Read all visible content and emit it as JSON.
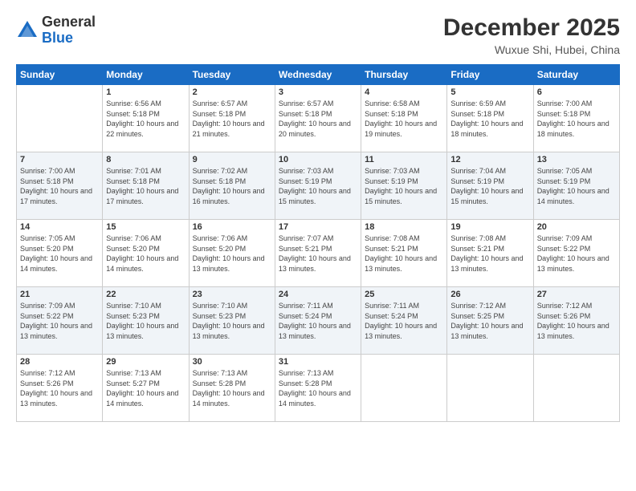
{
  "header": {
    "logo_general": "General",
    "logo_blue": "Blue",
    "title": "December 2025",
    "subtitle": "Wuxue Shi, Hubei, China"
  },
  "weekdays": [
    "Sunday",
    "Monday",
    "Tuesday",
    "Wednesday",
    "Thursday",
    "Friday",
    "Saturday"
  ],
  "weeks": [
    [
      {
        "day": "",
        "sunrise": "",
        "sunset": "",
        "daylight": ""
      },
      {
        "day": "1",
        "sunrise": "Sunrise: 6:56 AM",
        "sunset": "Sunset: 5:18 PM",
        "daylight": "Daylight: 10 hours and 22 minutes."
      },
      {
        "day": "2",
        "sunrise": "Sunrise: 6:57 AM",
        "sunset": "Sunset: 5:18 PM",
        "daylight": "Daylight: 10 hours and 21 minutes."
      },
      {
        "day": "3",
        "sunrise": "Sunrise: 6:57 AM",
        "sunset": "Sunset: 5:18 PM",
        "daylight": "Daylight: 10 hours and 20 minutes."
      },
      {
        "day": "4",
        "sunrise": "Sunrise: 6:58 AM",
        "sunset": "Sunset: 5:18 PM",
        "daylight": "Daylight: 10 hours and 19 minutes."
      },
      {
        "day": "5",
        "sunrise": "Sunrise: 6:59 AM",
        "sunset": "Sunset: 5:18 PM",
        "daylight": "Daylight: 10 hours and 18 minutes."
      },
      {
        "day": "6",
        "sunrise": "Sunrise: 7:00 AM",
        "sunset": "Sunset: 5:18 PM",
        "daylight": "Daylight: 10 hours and 18 minutes."
      }
    ],
    [
      {
        "day": "7",
        "sunrise": "Sunrise: 7:00 AM",
        "sunset": "Sunset: 5:18 PM",
        "daylight": "Daylight: 10 hours and 17 minutes."
      },
      {
        "day": "8",
        "sunrise": "Sunrise: 7:01 AM",
        "sunset": "Sunset: 5:18 PM",
        "daylight": "Daylight: 10 hours and 17 minutes."
      },
      {
        "day": "9",
        "sunrise": "Sunrise: 7:02 AM",
        "sunset": "Sunset: 5:18 PM",
        "daylight": "Daylight: 10 hours and 16 minutes."
      },
      {
        "day": "10",
        "sunrise": "Sunrise: 7:03 AM",
        "sunset": "Sunset: 5:19 PM",
        "daylight": "Daylight: 10 hours and 15 minutes."
      },
      {
        "day": "11",
        "sunrise": "Sunrise: 7:03 AM",
        "sunset": "Sunset: 5:19 PM",
        "daylight": "Daylight: 10 hours and 15 minutes."
      },
      {
        "day": "12",
        "sunrise": "Sunrise: 7:04 AM",
        "sunset": "Sunset: 5:19 PM",
        "daylight": "Daylight: 10 hours and 15 minutes."
      },
      {
        "day": "13",
        "sunrise": "Sunrise: 7:05 AM",
        "sunset": "Sunset: 5:19 PM",
        "daylight": "Daylight: 10 hours and 14 minutes."
      }
    ],
    [
      {
        "day": "14",
        "sunrise": "Sunrise: 7:05 AM",
        "sunset": "Sunset: 5:20 PM",
        "daylight": "Daylight: 10 hours and 14 minutes."
      },
      {
        "day": "15",
        "sunrise": "Sunrise: 7:06 AM",
        "sunset": "Sunset: 5:20 PM",
        "daylight": "Daylight: 10 hours and 14 minutes."
      },
      {
        "day": "16",
        "sunrise": "Sunrise: 7:06 AM",
        "sunset": "Sunset: 5:20 PM",
        "daylight": "Daylight: 10 hours and 13 minutes."
      },
      {
        "day": "17",
        "sunrise": "Sunrise: 7:07 AM",
        "sunset": "Sunset: 5:21 PM",
        "daylight": "Daylight: 10 hours and 13 minutes."
      },
      {
        "day": "18",
        "sunrise": "Sunrise: 7:08 AM",
        "sunset": "Sunset: 5:21 PM",
        "daylight": "Daylight: 10 hours and 13 minutes."
      },
      {
        "day": "19",
        "sunrise": "Sunrise: 7:08 AM",
        "sunset": "Sunset: 5:21 PM",
        "daylight": "Daylight: 10 hours and 13 minutes."
      },
      {
        "day": "20",
        "sunrise": "Sunrise: 7:09 AM",
        "sunset": "Sunset: 5:22 PM",
        "daylight": "Daylight: 10 hours and 13 minutes."
      }
    ],
    [
      {
        "day": "21",
        "sunrise": "Sunrise: 7:09 AM",
        "sunset": "Sunset: 5:22 PM",
        "daylight": "Daylight: 10 hours and 13 minutes."
      },
      {
        "day": "22",
        "sunrise": "Sunrise: 7:10 AM",
        "sunset": "Sunset: 5:23 PM",
        "daylight": "Daylight: 10 hours and 13 minutes."
      },
      {
        "day": "23",
        "sunrise": "Sunrise: 7:10 AM",
        "sunset": "Sunset: 5:23 PM",
        "daylight": "Daylight: 10 hours and 13 minutes."
      },
      {
        "day": "24",
        "sunrise": "Sunrise: 7:11 AM",
        "sunset": "Sunset: 5:24 PM",
        "daylight": "Daylight: 10 hours and 13 minutes."
      },
      {
        "day": "25",
        "sunrise": "Sunrise: 7:11 AM",
        "sunset": "Sunset: 5:24 PM",
        "daylight": "Daylight: 10 hours and 13 minutes."
      },
      {
        "day": "26",
        "sunrise": "Sunrise: 7:12 AM",
        "sunset": "Sunset: 5:25 PM",
        "daylight": "Daylight: 10 hours and 13 minutes."
      },
      {
        "day": "27",
        "sunrise": "Sunrise: 7:12 AM",
        "sunset": "Sunset: 5:26 PM",
        "daylight": "Daylight: 10 hours and 13 minutes."
      }
    ],
    [
      {
        "day": "28",
        "sunrise": "Sunrise: 7:12 AM",
        "sunset": "Sunset: 5:26 PM",
        "daylight": "Daylight: 10 hours and 13 minutes."
      },
      {
        "day": "29",
        "sunrise": "Sunrise: 7:13 AM",
        "sunset": "Sunset: 5:27 PM",
        "daylight": "Daylight: 10 hours and 14 minutes."
      },
      {
        "day": "30",
        "sunrise": "Sunrise: 7:13 AM",
        "sunset": "Sunset: 5:28 PM",
        "daylight": "Daylight: 10 hours and 14 minutes."
      },
      {
        "day": "31",
        "sunrise": "Sunrise: 7:13 AM",
        "sunset": "Sunset: 5:28 PM",
        "daylight": "Daylight: 10 hours and 14 minutes."
      },
      {
        "day": "",
        "sunrise": "",
        "sunset": "",
        "daylight": ""
      },
      {
        "day": "",
        "sunrise": "",
        "sunset": "",
        "daylight": ""
      },
      {
        "day": "",
        "sunrise": "",
        "sunset": "",
        "daylight": ""
      }
    ]
  ]
}
